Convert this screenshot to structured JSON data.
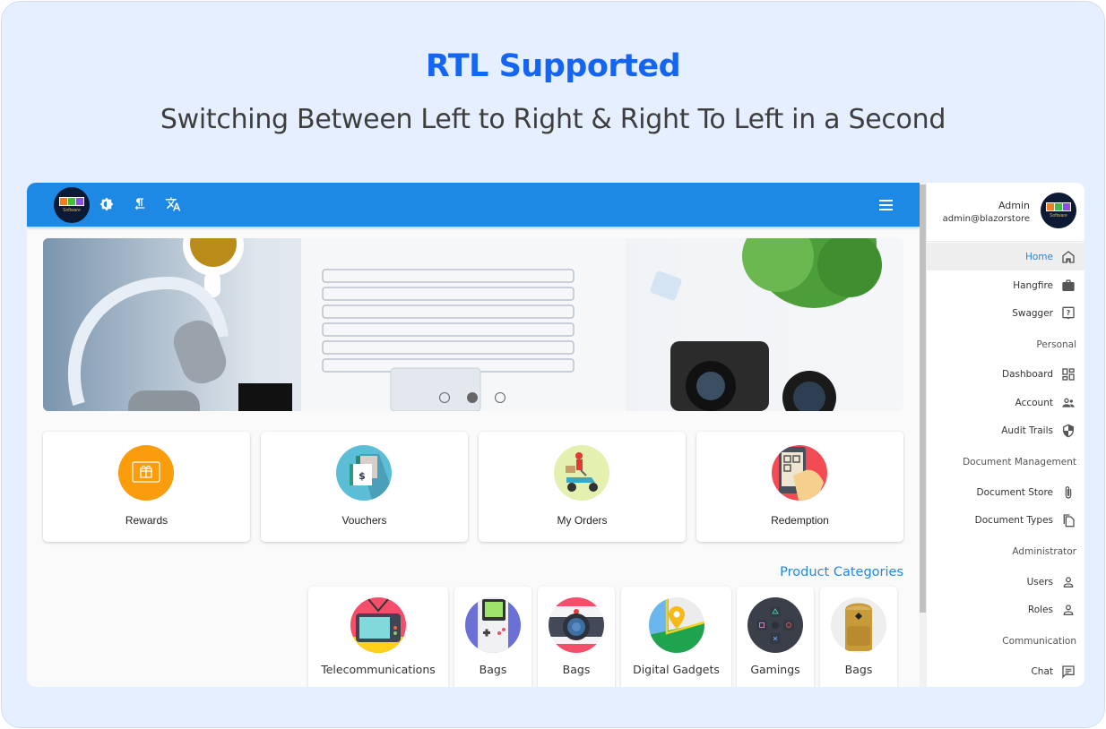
{
  "hero": {
    "title": "RTL Supported",
    "subtitle": "Switching Between Left to Right & Right To Left in a Second"
  },
  "colors": {
    "brand_blue": "#1e88e5",
    "title_blue": "#1565f5",
    "background": "#e5efff"
  },
  "topbar": {
    "logo_text": "Software",
    "icons": [
      "brightness-icon",
      "paragraph-rtl-icon",
      "translate-icon"
    ],
    "menu_icon": "hamburger-menu-icon"
  },
  "carousel": {
    "slides": 3,
    "active_slide": 2
  },
  "quick_cards": [
    {
      "label": "Rewards",
      "icon": "gift-card-icon"
    },
    {
      "label": "Vouchers",
      "icon": "voucher-icon"
    },
    {
      "label": "My Orders",
      "icon": "delivery-scooter-icon"
    },
    {
      "label": "Redemption",
      "icon": "qr-scan-icon"
    }
  ],
  "product_categories": {
    "title": "Product Categories",
    "items": [
      {
        "label": "Telecommunications",
        "icon": "tv-icon"
      },
      {
        "label": "Bags",
        "icon": "gameboy-icon"
      },
      {
        "label": "Bags",
        "icon": "camera-icon"
      },
      {
        "label": "Digital Gadgets",
        "icon": "map-pin-icon"
      },
      {
        "label": "Gamings",
        "icon": "gamepad-icon"
      },
      {
        "label": "Bags",
        "icon": "backpack-icon"
      }
    ]
  },
  "sidebar": {
    "user": {
      "name": "Admin",
      "email": "admin@blazorstore",
      "logo_text": "Software"
    },
    "items": [
      {
        "type": "item",
        "label": "Home",
        "icon": "home-icon",
        "active": true
      },
      {
        "type": "item",
        "label": "Hangfire",
        "icon": "briefcase-icon"
      },
      {
        "type": "item",
        "label": "Swagger",
        "icon": "help-box-icon"
      },
      {
        "type": "section",
        "label": "Personal"
      },
      {
        "type": "item",
        "label": "Dashboard",
        "icon": "dashboard-icon"
      },
      {
        "type": "item",
        "label": "Account",
        "icon": "account-group-icon"
      },
      {
        "type": "item",
        "label": "Audit Trails",
        "icon": "shield-icon"
      },
      {
        "type": "section",
        "label": "Document Management"
      },
      {
        "type": "item",
        "label": "Document Store",
        "icon": "paperclip-icon"
      },
      {
        "type": "item",
        "label": "Document Types",
        "icon": "copy-icon"
      },
      {
        "type": "section",
        "label": "Administrator"
      },
      {
        "type": "item",
        "label": "Users",
        "icon": "user-icon"
      },
      {
        "type": "item",
        "label": "Roles",
        "icon": "user-icon"
      },
      {
        "type": "section",
        "label": "Communication"
      },
      {
        "type": "item",
        "label": "Chat",
        "icon": "chat-icon"
      }
    ]
  }
}
